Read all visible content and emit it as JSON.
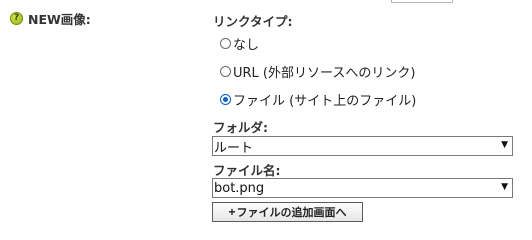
{
  "field": {
    "help_icon": "question-mark-icon",
    "help_glyph": "?",
    "label": "NEW画像:"
  },
  "link_type": {
    "heading": "リンクタイプ:",
    "options": [
      {
        "label": "なし",
        "checked": false
      },
      {
        "label": "URL (外部リソースへのリンク)",
        "checked": false
      },
      {
        "label": "ファイル (サイト上のファイル)",
        "checked": true
      }
    ]
  },
  "folder": {
    "heading": "フォルダ:",
    "selected": "ルート"
  },
  "file_name": {
    "heading": "ファイル名:",
    "selected": "bot.png"
  },
  "add_screen_button": {
    "icon_glyph": "+",
    "label": "ファイルの追加画面へ"
  },
  "colors": {
    "radio_checked": "#0a5fd1",
    "help_icon": "#9bbd1a"
  }
}
